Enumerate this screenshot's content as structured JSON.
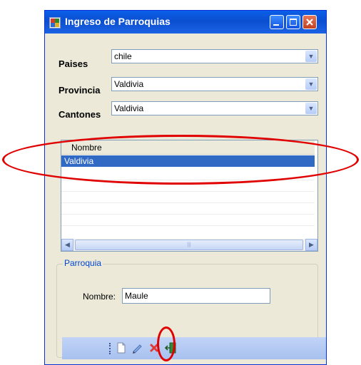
{
  "window": {
    "title": "Ingreso de Parroquias"
  },
  "form": {
    "paises_label": "Paises",
    "paises_value": "chile",
    "provincia_label": "Provincia",
    "provincia_value": "Valdivia",
    "cantones_label": "Cantones",
    "cantones_value": "Valdivia"
  },
  "list": {
    "column_header": "Nombre",
    "rows": [
      "Valdivia"
    ],
    "selected_index": 0
  },
  "group": {
    "title": "Parroquia",
    "nombre_label": "Nombre:",
    "nombre_value": "Maule"
  },
  "toolbar": {
    "buttons": [
      "new-document-icon",
      "edit-pencil-icon",
      "delete-x-icon",
      "exit-door-icon"
    ]
  },
  "annotation": {
    "color": "#e00000"
  }
}
